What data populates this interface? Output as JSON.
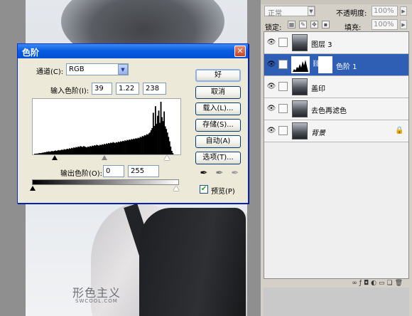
{
  "watermark": {
    "text": "形色主义",
    "sub": "SWCOOL.COM"
  },
  "dialog": {
    "title": "色阶",
    "close_glyph": "✕",
    "channel_label": "通道(C):",
    "channel_value": "RGB",
    "input_label": "输入色阶(I):",
    "input_black": "39",
    "input_gamma": "1.22",
    "input_white": "238",
    "output_label": "输出色阶(O):",
    "output_black": "0",
    "output_white": "255",
    "buttons": {
      "ok": "好",
      "cancel": "取消",
      "load": "载入(L)...",
      "save": "存储(S)...",
      "auto": "自动(A)",
      "options": "选项(T)..."
    },
    "preview_label": "预览(P)",
    "preview_checked": true
  },
  "layers_panel": {
    "blend_mode": "正常",
    "opacity_label": "不透明度:",
    "opacity_value": "100%",
    "lock_label": "锁定:",
    "fill_label": "填充:",
    "fill_value": "100%",
    "layers": [
      {
        "name": "图层 3",
        "selected": false,
        "italic": false
      },
      {
        "name": "色阶 1",
        "selected": true,
        "italic": false
      },
      {
        "name": "盖印",
        "selected": false,
        "italic": false
      },
      {
        "name": "去色再滤色",
        "selected": false,
        "italic": false
      },
      {
        "name": "背景",
        "selected": false,
        "italic": true
      }
    ],
    "bottom_icons": [
      "link-icon",
      "fx-icon",
      "mask-icon",
      "adjustment-icon",
      "folder-icon",
      "new-layer-icon",
      "trash-icon"
    ]
  },
  "histogram": {
    "bins": [
      1,
      1,
      2,
      2,
      3,
      3,
      3,
      4,
      4,
      5,
      5,
      6,
      6,
      7,
      6,
      7,
      8,
      7,
      8,
      9,
      8,
      9,
      10,
      9,
      10,
      11,
      10,
      12,
      11,
      12,
      13,
      12,
      14,
      13,
      15,
      14,
      16,
      15,
      17,
      16,
      18,
      17,
      19,
      18,
      17,
      19,
      18,
      17,
      16,
      18,
      17,
      19,
      18,
      20,
      19,
      21,
      20,
      22,
      21,
      20,
      22,
      21,
      23,
      22,
      24,
      23,
      25,
      24,
      26,
      25,
      27,
      26,
      28,
      27,
      26,
      28,
      27,
      29,
      28,
      30,
      29,
      31,
      30,
      32,
      31,
      33,
      32,
      34,
      33,
      35,
      34,
      36,
      35,
      37,
      36,
      38,
      37,
      40,
      39,
      42,
      41,
      44,
      43,
      46,
      45,
      48,
      50,
      55,
      60,
      95,
      65,
      110,
      70,
      88,
      100,
      72,
      120,
      85,
      76,
      98,
      64,
      58,
      50,
      40,
      30,
      18,
      8,
      3
    ]
  }
}
